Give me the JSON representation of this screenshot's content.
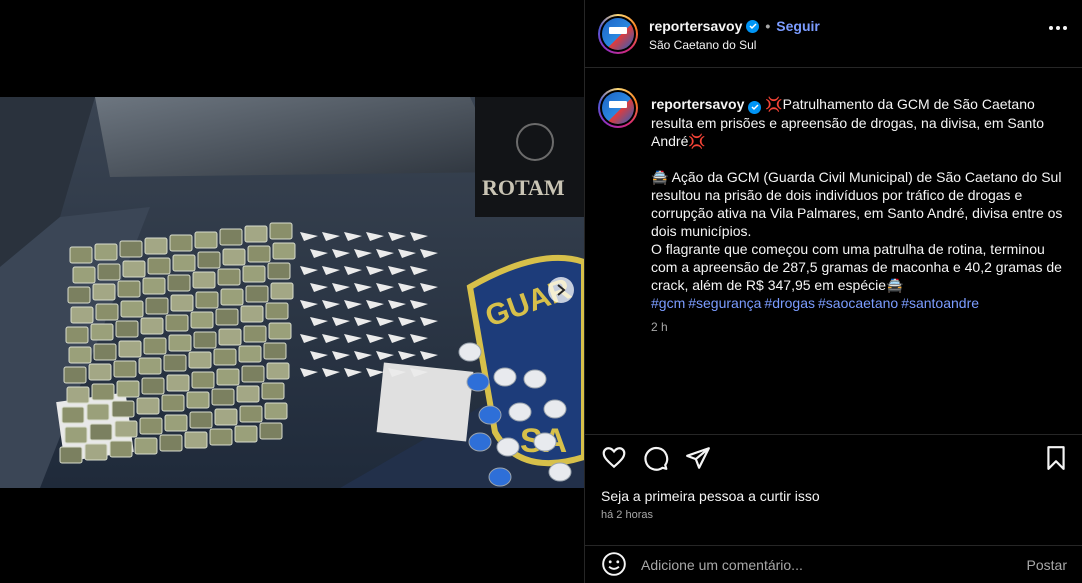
{
  "post": {
    "username": "reportersavoy",
    "follow_label": "Seguir",
    "separator": "•",
    "location": "São Caetano do Sul",
    "image_alt": "Apreensão de drogas sobre capô de viatura ROTAM",
    "vest_text": "ROTAM",
    "carousel": {
      "current": 1,
      "total": 2
    }
  },
  "caption": {
    "username": "reportersavoy",
    "headline_emoji": "💢",
    "headline": "Patrulhamento da GCM de São Caetano resulta em prisões e apreensão de drogas, na divisa, em Santo André",
    "car_emoji": "🚔",
    "para1": "Ação da GCM (Guarda Civil Municipal) de São Caetano do Sul resultou na prisão de dois indivíduos por tráfico de drogas e corrupção ativa na Vila Palmares, em Santo André, divisa entre os dois municípios.",
    "para2": "O flagrante que começou com uma patrulha de rotina, terminou com a apreensão de 287,5 gramas de maconha e 40,2 gramas de crack, além de R$ 347,95 em espécie",
    "hashtags": [
      "#gcm",
      "#segurança",
      "#drogas",
      "#saocaetano",
      "#santoandre"
    ],
    "time": "2 h"
  },
  "engagement": {
    "likes_text": "Seja a primeira pessoa a curtir isso",
    "posted_ago": "há 2 horas"
  },
  "comment": {
    "placeholder": "Adicione um comentário...",
    "post_label": "Postar"
  },
  "colors": {
    "background": "#000000",
    "link": "#7b9cff",
    "verified": "#0095f6",
    "muted": "#a8a8a8"
  }
}
